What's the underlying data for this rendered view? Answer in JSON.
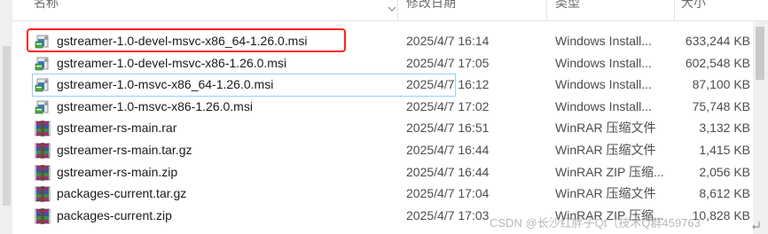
{
  "columns": {
    "name": "名称",
    "date": "修改日期",
    "type": "类型",
    "size": "大小"
  },
  "files": [
    {
      "name": "gstreamer-1.0-devel-msvc-x86_64-1.26.0.msi",
      "date": "2025/4/7 16:14",
      "type": "Windows Install...",
      "size": "633,244 KB",
      "icon": "msi-installer-icon",
      "highlighted": true
    },
    {
      "name": "gstreamer-1.0-devel-msvc-x86-1.26.0.msi",
      "date": "2025/4/7 17:05",
      "type": "Windows Install...",
      "size": "602,548 KB",
      "icon": "msi-installer-icon"
    },
    {
      "name": "gstreamer-1.0-msvc-x86_64-1.26.0.msi",
      "date": "2025/4/7 16:12",
      "type": "Windows Install...",
      "size": "87,100 KB",
      "icon": "msi-installer-icon",
      "focused": true
    },
    {
      "name": "gstreamer-1.0-msvc-x86-1.26.0.msi",
      "date": "2025/4/7 17:02",
      "type": "Windows Install...",
      "size": "75,748 KB",
      "icon": "msi-installer-icon"
    },
    {
      "name": "gstreamer-rs-main.rar",
      "date": "2025/4/7 16:51",
      "type": "WinRAR 压缩文件",
      "size": "3,132 KB",
      "icon": "winrar-archive-icon"
    },
    {
      "name": "gstreamer-rs-main.tar.gz",
      "date": "2025/4/7 16:44",
      "type": "WinRAR 压缩文件",
      "size": "1,415 KB",
      "icon": "winrar-archive-icon"
    },
    {
      "name": "gstreamer-rs-main.zip",
      "date": "2025/4/7 16:44",
      "type": "WinRAR ZIP 压缩...",
      "size": "2,056 KB",
      "icon": "winrar-archive-icon"
    },
    {
      "name": "packages-current.tar.gz",
      "date": "2025/4/7 17:04",
      "type": "WinRAR 压缩文件",
      "size": "8,612 KB",
      "icon": "winrar-archive-icon"
    },
    {
      "name": "packages-current.zip",
      "date": "2025/4/7 17:03",
      "type": "WinRAR ZIP 压缩...",
      "size": "10,828 KB",
      "icon": "winrar-archive-icon"
    }
  ],
  "watermark": "CSDN @长沙红胖子Qt（技术Q群459763",
  "colors": {
    "highlight": "#ff1f1f",
    "focus_outline": "#99ccff",
    "header_text": "#6b6b6b",
    "row_text": "#1a1a1a"
  }
}
